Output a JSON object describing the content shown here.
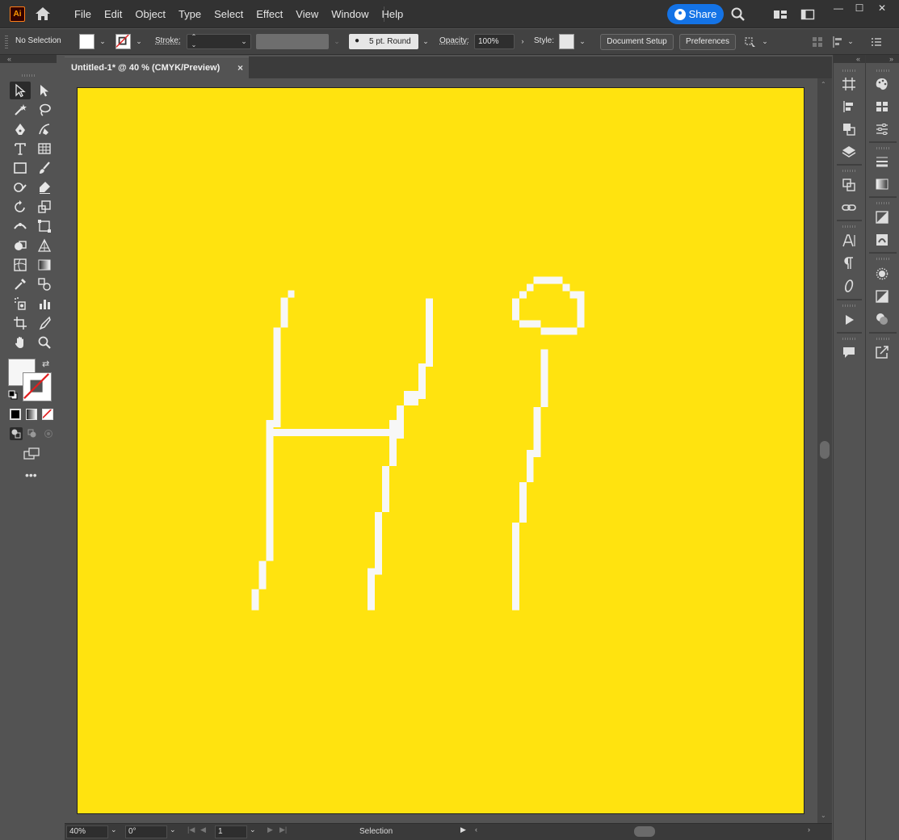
{
  "app": {
    "logo_text": "Ai",
    "menu": [
      "File",
      "Edit",
      "Object",
      "Type",
      "Select",
      "Effect",
      "View",
      "Window",
      "Help"
    ],
    "share_label": "Share"
  },
  "control_bar": {
    "selection_status": "No Selection",
    "stroke_label": "Stroke:",
    "brush_label": "5 pt. Round",
    "opacity_label": "Opacity:",
    "opacity_value": "100%",
    "style_label": "Style:",
    "document_setup_label": "Document Setup",
    "preferences_label": "Preferences"
  },
  "document": {
    "tab_title": "Untitled-1* @ 40 % (CMYK/Preview)",
    "close_glyph": "×",
    "artboard_color": "#ffe30f"
  },
  "status_bar": {
    "zoom": "40%",
    "rotation": "0°",
    "artboard_number": "1",
    "tool_name": "Selection"
  },
  "colors": {
    "accent": "#1473e6",
    "fill": "#ffffff",
    "stroke": "none"
  }
}
